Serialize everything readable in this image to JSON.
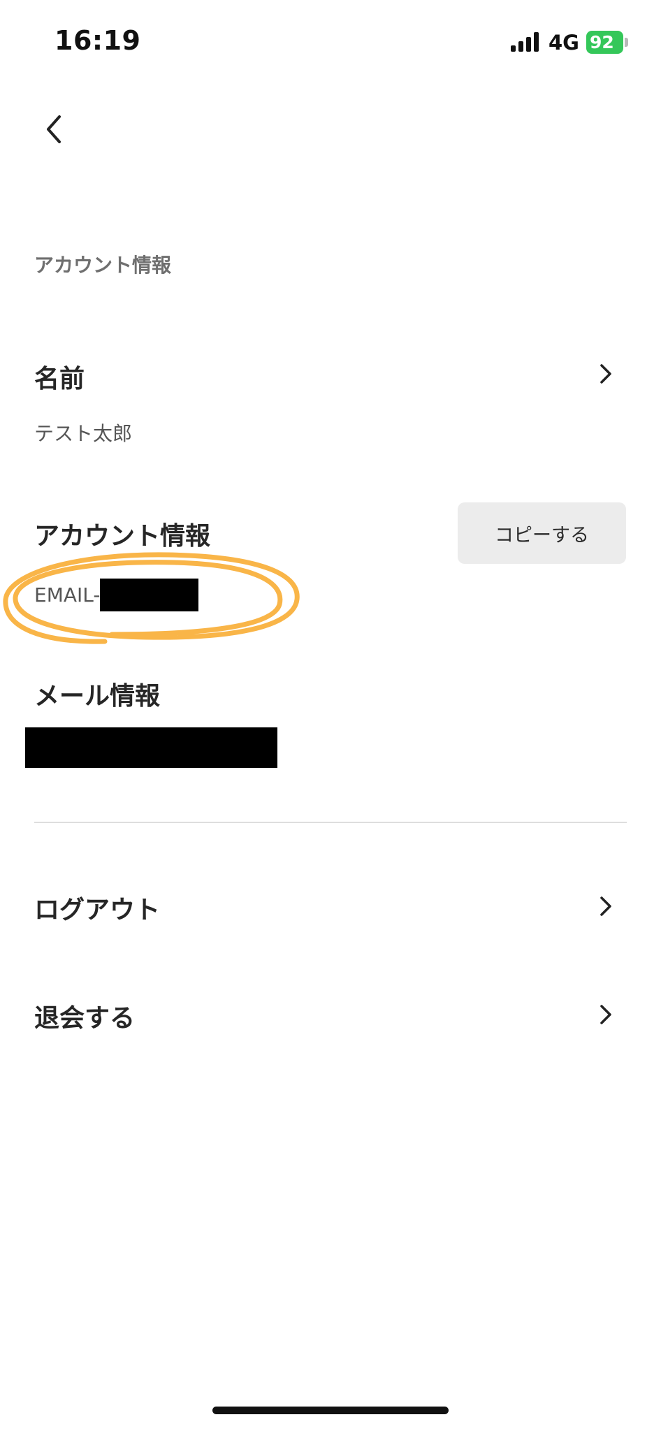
{
  "status_bar": {
    "time": "16:19",
    "network": "4G",
    "battery": "92"
  },
  "section_caption": "アカウント情報",
  "name_row": {
    "title": "名前",
    "value": "テスト太郎"
  },
  "account_row": {
    "title": "アカウント情報",
    "id_prefix": "EMAIL-",
    "copy_button": "コピーする"
  },
  "mail_row": {
    "title": "メール情報"
  },
  "menu": {
    "logout": "ログアウト",
    "withdraw": "退会する"
  },
  "icons": {
    "back": "chevron-left-icon",
    "chevron": "chevron-right-icon",
    "signal": "signal-icon",
    "battery": "battery-charging-icon"
  },
  "colors": {
    "annotation": "#f9b548",
    "battery": "#34c759",
    "copy_button_bg": "#ececec",
    "divider": "#dedede"
  }
}
